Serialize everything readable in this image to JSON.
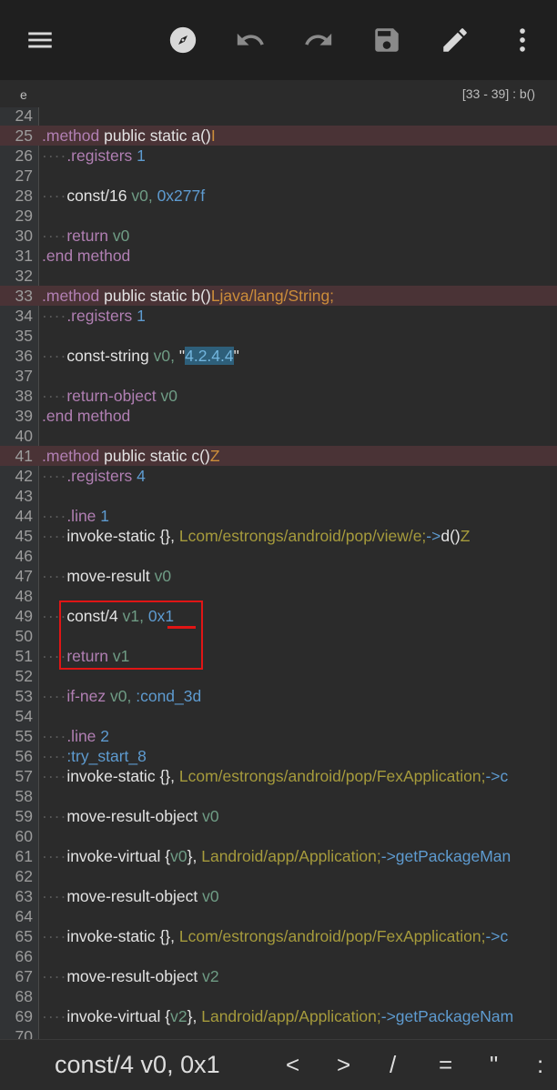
{
  "toolbar": {
    "icons": [
      "menu-icon",
      "compass-icon",
      "undo-icon",
      "redo-icon",
      "save-icon",
      "edit-icon",
      "more-vert-icon"
    ]
  },
  "status": {
    "file": "e",
    "position": "[33 - 39] : b()"
  },
  "editor": {
    "lines": {
      "l24": "24",
      "l25": "25",
      "l25a": ".method",
      "l25b": "public static",
      "l25c": "a()",
      "l25d": "I",
      "l26": "26",
      "l26a": ".registers",
      "l26b": "1",
      "l27": "27",
      "l28": "28",
      "l28a": "const/16",
      "l28b": "v0,",
      "l28c": "0x277f",
      "l29": "29",
      "l30": "30",
      "l30a": "return",
      "l30b": "v0",
      "l31": "31",
      "l31a": ".end method",
      "l32": "32",
      "l33": "33",
      "l33a": ".method",
      "l33b": "public static",
      "l33c": "b()",
      "l33d": "Ljava/lang/String;",
      "l34": "34",
      "l34a": ".registers",
      "l34b": "1",
      "l35": "35",
      "l36": "36",
      "l36a": "const-string",
      "l36b": "v0,",
      "l36c": "\"",
      "l36d": "4.2.4.4",
      "l36e": "\"",
      "l37": "37",
      "l38": "38",
      "l38a": "return-object",
      "l38b": "v0",
      "l39": "39",
      "l39a": ".end method",
      "l40": "40",
      "l41": "41",
      "l41a": ".method",
      "l41b": "public static",
      "l41c": "c()",
      "l41d": "Z",
      "l42": "42",
      "l42a": ".registers",
      "l42b": "4",
      "l43": "43",
      "l44": "44",
      "l44a": ".line",
      "l44b": "1",
      "l45": "45",
      "l45a": "invoke-static",
      "l45b": "{},",
      "l45c": "Lcom/estrongs/android/pop/view/e;",
      "l45d": "->",
      "l45e": "d()",
      "l45f": "Z",
      "l46": "46",
      "l47": "47",
      "l47a": "move-result",
      "l47b": "v0",
      "l48": "48",
      "l49": "49",
      "l49a": "const/4",
      "l49b": "v1,",
      "l49c": "0x1",
      "l50": "50",
      "l51": "51",
      "l51a": "return",
      "l51b": "v1",
      "l52": "52",
      "l53": "53",
      "l53a": "if-nez",
      "l53b": "v0,",
      "l53c": ":cond_3d",
      "l54": "54",
      "l55": "55",
      "l55a": ".line",
      "l55b": "2",
      "l56": "56",
      "l56a": ":try_start_8",
      "l57": "57",
      "l57a": "invoke-static",
      "l57b": "{},",
      "l57c": "Lcom/estrongs/android/pop/FexApplication;",
      "l57d": "->c",
      "l58": "58",
      "l59": "59",
      "l59a": "move-result-object",
      "l59b": "v0",
      "l60": "60",
      "l61": "61",
      "l61a": "invoke-virtual",
      "l61b": "{",
      "l61c": "v0",
      "l61d": "},",
      "l61e": "Landroid/app/Application;",
      "l61f": "->getPackageMan",
      "l62": "62",
      "l63": "63",
      "l63a": "move-result-object",
      "l63b": "v0",
      "l64": "64",
      "l65": "65",
      "l65a": "invoke-static",
      "l65b": "{},",
      "l65c": "Lcom/estrongs/android/pop/FexApplication;",
      "l65d": "->c",
      "l66": "66",
      "l67": "67",
      "l67a": "move-result-object",
      "l67b": "v2",
      "l68": "68",
      "l69": "69",
      "l69a": "invoke-virtual",
      "l69b": "{",
      "l69c": "v2",
      "l69d": "},",
      "l69e": "Landroid/app/Application;",
      "l69f": "->getPackageNam",
      "l70": "70"
    },
    "dots": "····"
  },
  "bottom": {
    "current_line": "const/4 v0, 0x1",
    "keys": [
      "<",
      ">",
      "/",
      "=",
      "\"",
      ":"
    ]
  },
  "colors": {
    "keyword": "#b17fb3",
    "register": "#6f9c85",
    "literal": "#5e9bd0",
    "type": "#a69b3c",
    "highlight_line": "#4a3336",
    "annotation": "#e01515"
  }
}
